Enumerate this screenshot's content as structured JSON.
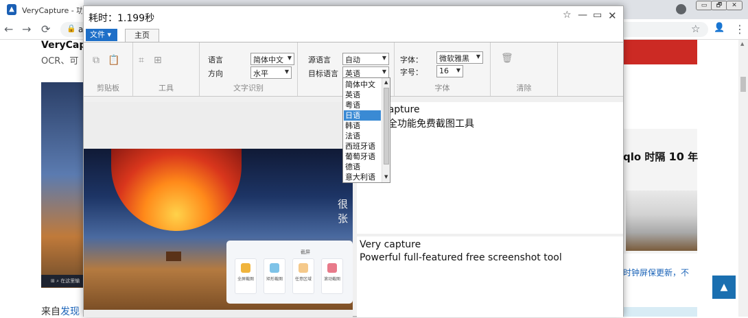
{
  "browser": {
    "tab_title": "VeryCapture - 功能",
    "url_visible": "a",
    "nav": {
      "back": "←",
      "forward": "→",
      "reload": "⟳",
      "lock": "🔒"
    },
    "winbtns": [
      "▭",
      "🗗",
      "✕"
    ],
    "right_icons": {
      "star": "☆",
      "profile": "👤",
      "menu": "⋮"
    }
  },
  "page": {
    "title": "VeryCap",
    "subtitle": "OCR、可",
    "from_prefix": "来自",
    "from_link": "发现",
    "taskbar_text": "⊞ ⌕ 在这里输",
    "right_title_main": "qlo 时隔 ",
    "right_title_bold": "10",
    "right_title_tail": " 年",
    "right_link": "时钟屏保更新，不",
    "back_to_top": "▲"
  },
  "app": {
    "title": "耗时：1.199秒",
    "titlebar_icons": {
      "pin": "☆",
      "minimize": "—",
      "maximize": "▭",
      "close": "✕"
    },
    "file_label": "文件 ▾",
    "home_tab": "主页",
    "ribbon": {
      "clipboard": {
        "name": "剪贴板",
        "icons": [
          "⧉",
          "📋"
        ]
      },
      "tools": {
        "name": "工具",
        "icons": [
          "⌗",
          "⊞"
        ]
      },
      "ocr": {
        "name": "文字识别",
        "language_label": "语言",
        "language_value": "简体中文",
        "direction_label": "方向",
        "direction_value": "水平"
      },
      "translate": {
        "source_label": "源语言",
        "source_value": "自动",
        "target_label": "目标语言",
        "target_value": "英语"
      },
      "font": {
        "name": "字体",
        "family_label": "字体：",
        "family_value": "微软雅黑",
        "size_label": "字号：",
        "size_value": "16"
      },
      "clear": {
        "name": "清除",
        "icon": "🗑"
      }
    },
    "dropdown": {
      "items": [
        "简体中文",
        "英语",
        "粤语",
        "日语",
        "韩语",
        "法语",
        "西班牙语",
        "葡萄牙语",
        "德语",
        "意大利语"
      ],
      "selected_index": 3
    },
    "image": {
      "overlay_text": "很张",
      "dialog_title": "截屏",
      "cards": [
        {
          "label": "全屏截图",
          "color": "#f0b43c"
        },
        {
          "label": "矩形截图",
          "color": "#7ec3e8"
        },
        {
          "label": "任意区域",
          "color": "#f5c98a"
        },
        {
          "label": "滚动截图",
          "color": "#e87a8a"
        }
      ]
    },
    "ocr_text": {
      "line1": "capture",
      "line2": "全功能免费截图工具"
    },
    "translation_text": {
      "line1": "Very capture",
      "line2": "Powerful full-featured free screenshot tool"
    }
  }
}
